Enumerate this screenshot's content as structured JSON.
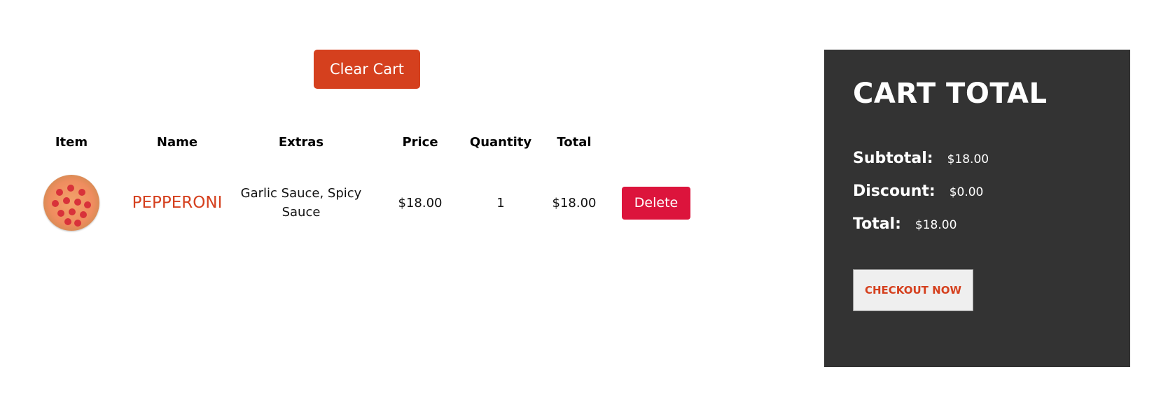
{
  "actions": {
    "clear_cart_label": "Clear Cart"
  },
  "table": {
    "headers": {
      "item": "Item",
      "name": "Name",
      "extras": "Extras",
      "price": "Price",
      "quantity": "Quantity",
      "total": "Total"
    },
    "rows": [
      {
        "item_icon": "pizza-image",
        "name": "PEPPERONI",
        "extras": "Garlic Sauce, Spicy Sauce",
        "price": "$18.00",
        "quantity": "1",
        "total": "$18.00",
        "delete_label": "Delete"
      }
    ]
  },
  "cart_total": {
    "title": "CART TOTAL",
    "subtotal_label": "Subtotal:",
    "subtotal_value": "$18.00",
    "discount_label": "Discount:",
    "discount_value": "$0.00",
    "total_label": "Total:",
    "total_value": "$18.00",
    "checkout_label": "CHECKOUT NOW"
  },
  "colors": {
    "accent": "#d5401e",
    "delete": "#dc143c",
    "panel_bg": "#333333"
  }
}
